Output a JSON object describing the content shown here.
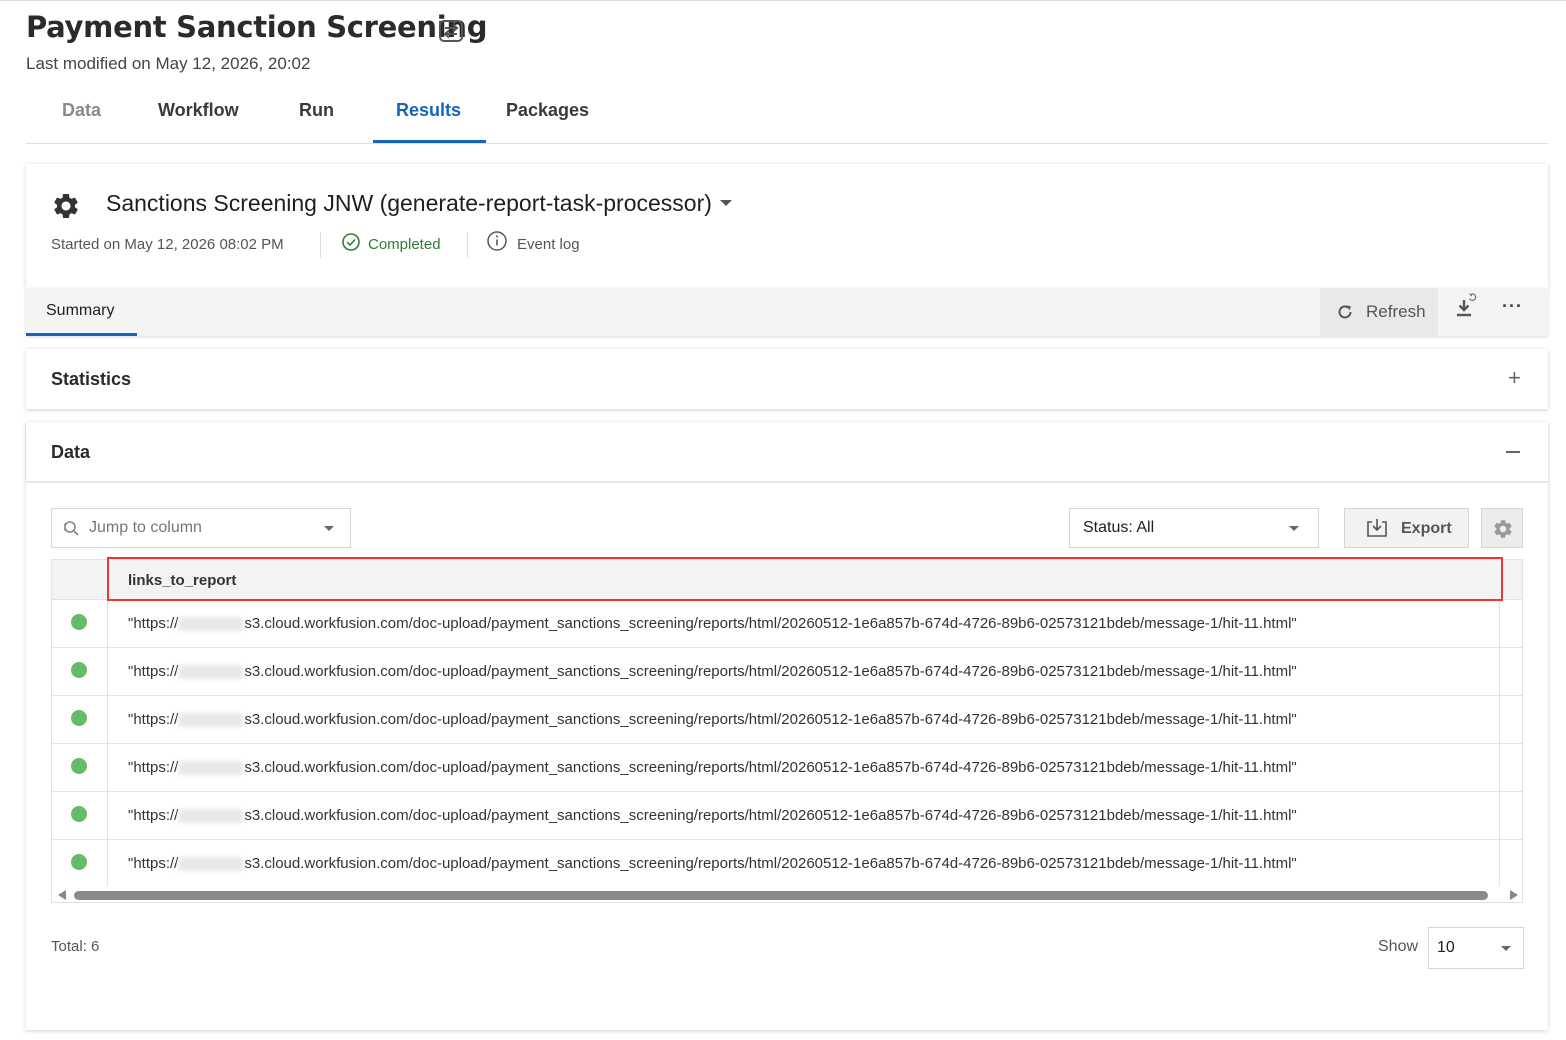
{
  "header": {
    "title": "Payment Sanction Screening",
    "title_icon": "transfer-icon",
    "subtitle": "Last modified on May 12, 2026, 20:02"
  },
  "tabs": [
    {
      "label": "Data",
      "state": "disabled"
    },
    {
      "label": "Workflow",
      "state": "normal"
    },
    {
      "label": "Run",
      "state": "normal"
    },
    {
      "label": "Results",
      "state": "active"
    },
    {
      "label": "Packages",
      "state": "normal"
    }
  ],
  "run": {
    "title": "Sanctions Screening JNW (generate-report-task-processor)",
    "started": "Started on May 12, 2026 08:02 PM",
    "status": "Completed",
    "event_log": "Event log"
  },
  "subtabs": {
    "summary": "Summary",
    "refresh": "Refresh"
  },
  "sections": {
    "statistics": "Statistics",
    "data": "Data"
  },
  "toolbar": {
    "jump_placeholder": "Jump to column",
    "status_filter": "Status: All",
    "export": "Export"
  },
  "table": {
    "column": "links_to_report",
    "rows": [
      {
        "status": "success",
        "prefix": "\"https://",
        "value": "s3.cloud.workfusion.com/doc-upload/payment_sanctions_screening/reports/html/20260512-1e6a857b-674d-4726-89b6-02573121bdeb/message-1/hit-11.html\""
      },
      {
        "status": "success",
        "prefix": "\"https://",
        "value": "s3.cloud.workfusion.com/doc-upload/payment_sanctions_screening/reports/html/20260512-1e6a857b-674d-4726-89b6-02573121bdeb/message-1/hit-11.html\""
      },
      {
        "status": "success",
        "prefix": "\"https://",
        "value": "s3.cloud.workfusion.com/doc-upload/payment_sanctions_screening/reports/html/20260512-1e6a857b-674d-4726-89b6-02573121bdeb/message-1/hit-11.html\""
      },
      {
        "status": "success",
        "prefix": "\"https://",
        "value": "s3.cloud.workfusion.com/doc-upload/payment_sanctions_screening/reports/html/20260512-1e6a857b-674d-4726-89b6-02573121bdeb/message-1/hit-11.html\""
      },
      {
        "status": "success",
        "prefix": "\"https://",
        "value": "s3.cloud.workfusion.com/doc-upload/payment_sanctions_screening/reports/html/20260512-1e6a857b-674d-4726-89b6-02573121bdeb/message-1/hit-11.html\""
      },
      {
        "status": "success",
        "prefix": "\"https://",
        "value": "s3.cloud.workfusion.com/doc-upload/payment_sanctions_screening/reports/html/20260512-1e6a857b-674d-4726-89b6-02573121bdeb/message-1/hit-11.html\""
      }
    ]
  },
  "footer": {
    "total": "Total: 6",
    "show_label": "Show",
    "page_size": "10"
  },
  "colors": {
    "accent": "#1565c0",
    "success": "#2e7d32",
    "status_dot": "#66bb6a",
    "highlight": "#e53935"
  }
}
